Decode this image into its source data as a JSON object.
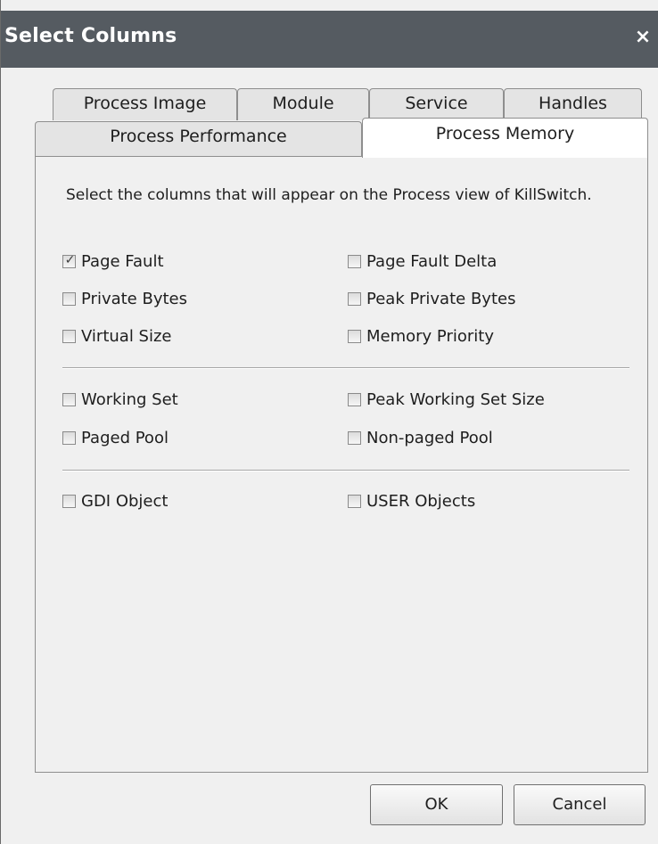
{
  "dialog": {
    "title": "Select Columns",
    "close_symbol": "×"
  },
  "tabs": {
    "row1": [
      "Process Image",
      "Module",
      "Service",
      "Handles"
    ],
    "row2": [
      "Process Performance",
      "Process Memory"
    ],
    "active": "Process Memory"
  },
  "panel": {
    "description": "Select the columns that will appear on the Process view of KillSwitch.",
    "groups": [
      [
        {
          "label": "Page Fault",
          "checked": true
        },
        {
          "label": "Page Fault Delta",
          "checked": false
        },
        {
          "label": "Private Bytes",
          "checked": false
        },
        {
          "label": "Peak Private Bytes",
          "checked": false
        },
        {
          "label": "Virtual Size",
          "checked": false
        },
        {
          "label": "Memory Priority",
          "checked": false
        }
      ],
      [
        {
          "label": "Working Set",
          "checked": false
        },
        {
          "label": "Peak Working Set Size",
          "checked": false
        },
        {
          "label": "Paged Pool",
          "checked": false
        },
        {
          "label": "Non-paged Pool",
          "checked": false
        }
      ],
      [
        {
          "label": "GDI Object",
          "checked": false
        },
        {
          "label": "USER Objects",
          "checked": false
        }
      ]
    ],
    "check_glyph": "✓"
  },
  "buttons": {
    "ok": "OK",
    "cancel": "Cancel"
  },
  "icons": {
    "close": "close-icon",
    "check": "checkmark-icon"
  }
}
